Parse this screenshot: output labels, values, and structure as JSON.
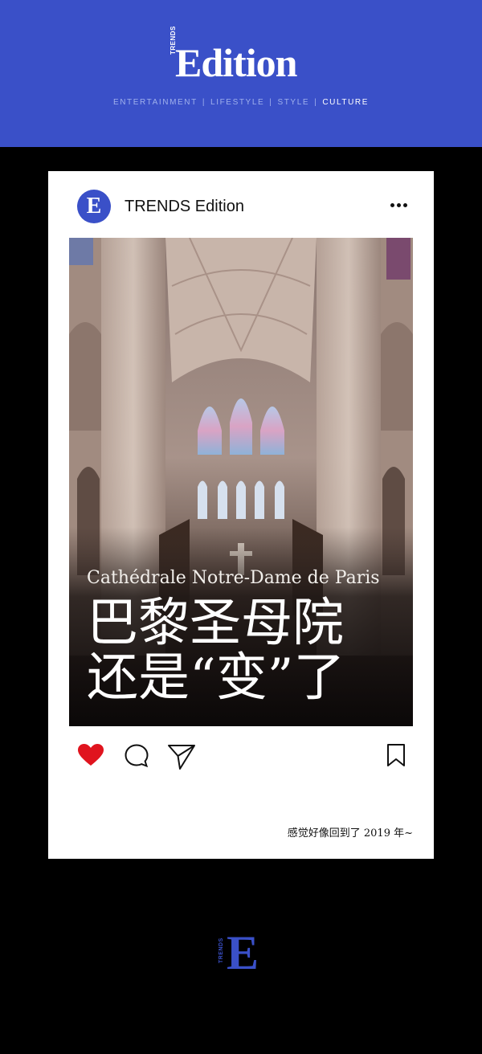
{
  "brand": {
    "small_tag": "TRENDS",
    "name": "Edition",
    "colors": {
      "primary": "#3a50c8",
      "like": "#e0141e"
    }
  },
  "nav": {
    "items": [
      {
        "label": "ENTERTAINMENT",
        "active": false
      },
      {
        "label": "LIFESTYLE",
        "active": false
      },
      {
        "label": "STYLE",
        "active": false
      },
      {
        "label": "CULTURE",
        "active": true
      }
    ],
    "separator": "|"
  },
  "post": {
    "account_name": "TRENDS Edition",
    "avatar_letter": "E",
    "photo": {
      "subtitle": "Cathédrale Notre-Dame de Paris",
      "title_line1": "巴黎圣母院",
      "title_line2": "还是“变”了"
    },
    "caption": "感觉好像回到了 2019 年~",
    "icons": {
      "more": "more-dots-icon",
      "like": "heart-icon",
      "comment": "comment-icon",
      "share": "send-icon",
      "bookmark": "bookmark-icon"
    }
  },
  "footer": {
    "logo_letter": "E",
    "logo_tag": "TRENDS"
  }
}
